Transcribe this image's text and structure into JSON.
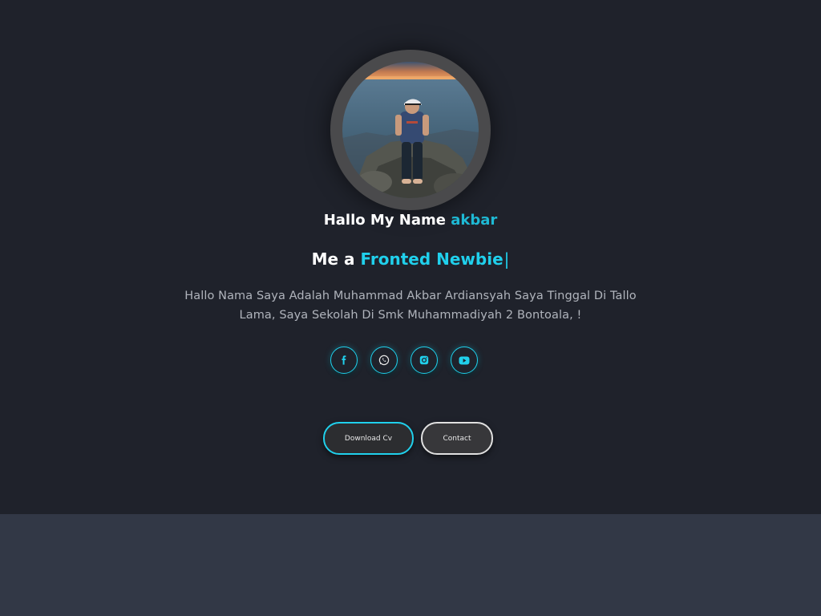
{
  "hero": {
    "greeting_prefix": "Hallo My Name ",
    "greeting_name": "akbar",
    "role_prefix": "Me a ",
    "role_title": "Fronted Newbie",
    "role_caret": "|",
    "bio": "Hallo Nama Saya Adalah Muhammad Akbar Ardiansyah Saya Tinggal Di Tallo Lama, Saya Sekolah Di Smk Muhammadiyah 2 Bontoala, !"
  },
  "socials": [
    {
      "icon": "facebook-icon"
    },
    {
      "icon": "whatsapp-icon"
    },
    {
      "icon": "instagram-icon"
    },
    {
      "icon": "youtube-icon"
    }
  ],
  "buttons": {
    "download_cv": "Download Cv",
    "contact": "Contact"
  },
  "colors": {
    "accent": "#20d0ec",
    "hero_bg": "#1f222b",
    "lower_bg": "#323846",
    "text": "#ffffff",
    "muted_text": "#b0b4bc"
  }
}
